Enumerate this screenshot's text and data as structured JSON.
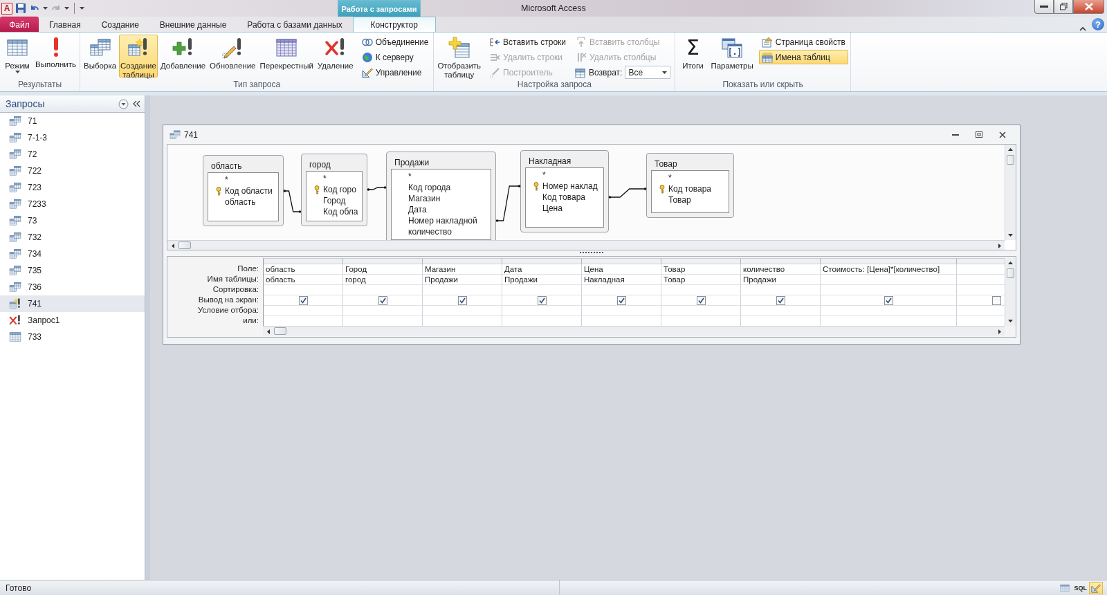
{
  "window": {
    "title": "Microsoft Access",
    "app_icon": "A",
    "help": "?"
  },
  "context_tab": {
    "label": "Работа с запросами"
  },
  "tabs": [
    {
      "label": "Файл",
      "kind": "file",
      "selected": false
    },
    {
      "label": "Главная",
      "kind": "tab",
      "selected": false
    },
    {
      "label": "Создание",
      "kind": "tab",
      "selected": false
    },
    {
      "label": "Внешние данные",
      "kind": "tab",
      "selected": false
    },
    {
      "label": "Работа с базами данных",
      "kind": "tab",
      "selected": false
    },
    {
      "label": "Конструктор",
      "kind": "tab",
      "selected": true
    }
  ],
  "ribbon": {
    "groups": [
      {
        "label": "Результаты",
        "items": [
          {
            "kind": "large",
            "label": "Режим",
            "dropdown": true,
            "selected": false
          },
          {
            "kind": "large",
            "label": "Выполнить",
            "selected": false
          }
        ]
      },
      {
        "label": "Тип запроса",
        "items": [
          {
            "kind": "large",
            "label": "Выборка",
            "selected": false
          },
          {
            "kind": "large",
            "label": "Создание таблицы",
            "selected": true
          },
          {
            "kind": "large",
            "label": "Добавление",
            "selected": false
          },
          {
            "kind": "large",
            "label": "Обновление",
            "selected": false
          },
          {
            "kind": "large",
            "label": "Перекрестный",
            "selected": false
          },
          {
            "kind": "large",
            "label": "Удаление",
            "selected": false
          },
          {
            "kind": "stack",
            "items": [
              {
                "kind": "small",
                "label": "Объединение",
                "disabled": false
              },
              {
                "kind": "small",
                "label": "К серверу",
                "disabled": false
              },
              {
                "kind": "small",
                "label": "Управление",
                "disabled": false
              }
            ]
          }
        ]
      },
      {
        "label": "Настройка запроса",
        "items": [
          {
            "kind": "large",
            "label": "Отобразить таблицу",
            "selected": false
          },
          {
            "kind": "stack",
            "items": [
              {
                "kind": "small",
                "label": "Вставить строки",
                "disabled": false
              },
              {
                "kind": "small",
                "label": "Удалить строки",
                "disabled": true
              },
              {
                "kind": "small",
                "label": "Построитель",
                "disabled": true
              }
            ]
          },
          {
            "kind": "stack",
            "items": [
              {
                "kind": "small",
                "label": "Вставить столбцы",
                "disabled": true
              },
              {
                "kind": "small",
                "label": "Удалить столбцы",
                "disabled": true
              },
              {
                "kind": "combo",
                "label": "Возврат:",
                "value": "Все"
              }
            ]
          }
        ]
      },
      {
        "label": "Показать или скрыть",
        "items": [
          {
            "kind": "large",
            "symbol": "Σ",
            "label": "Итоги",
            "selected": false
          },
          {
            "kind": "large",
            "label": "Параметры",
            "selected": false
          },
          {
            "kind": "stack",
            "items": [
              {
                "kind": "small",
                "label": "Страница свойств",
                "selected": false,
                "disabled": false
              },
              {
                "kind": "small",
                "label": "Имена таблиц",
                "selected": true,
                "disabled": false
              }
            ]
          }
        ]
      }
    ]
  },
  "nav": {
    "title": "Запросы",
    "items": [
      {
        "label": "71",
        "kind": "select",
        "selected": false
      },
      {
        "label": "7-1-3",
        "kind": "select",
        "selected": false
      },
      {
        "label": "72",
        "kind": "select",
        "selected": false
      },
      {
        "label": "722",
        "kind": "select",
        "selected": false
      },
      {
        "label": "723",
        "kind": "select",
        "selected": false
      },
      {
        "label": "7233",
        "kind": "select",
        "selected": false
      },
      {
        "label": "73",
        "kind": "select",
        "selected": false
      },
      {
        "label": "732",
        "kind": "select",
        "selected": false
      },
      {
        "label": "734",
        "kind": "select",
        "selected": false
      },
      {
        "label": "735",
        "kind": "select",
        "selected": false
      },
      {
        "label": "736",
        "kind": "select",
        "selected": false
      },
      {
        "label": "741",
        "kind": "maketable",
        "selected": true
      },
      {
        "label": "Запрос1",
        "kind": "delete",
        "selected": false
      },
      {
        "label": "733",
        "kind": "table",
        "selected": false
      }
    ]
  },
  "query": {
    "title": "741",
    "tables": [
      {
        "name": "область",
        "fields": [
          {
            "name": "*",
            "key": false
          },
          {
            "name": "Код области",
            "key": true
          },
          {
            "name": "область",
            "key": false
          }
        ]
      },
      {
        "name": "город",
        "fields": [
          {
            "name": "*",
            "key": false
          },
          {
            "name": "Код горо",
            "key": true
          },
          {
            "name": "Город",
            "key": false
          },
          {
            "name": "Код обла",
            "key": false
          }
        ]
      },
      {
        "name": "Продажи",
        "fields": [
          {
            "name": "*",
            "key": false
          },
          {
            "name": "Код города",
            "key": false
          },
          {
            "name": "Магазин",
            "key": false
          },
          {
            "name": "Дата",
            "key": false
          },
          {
            "name": "Номер накладной",
            "key": false
          },
          {
            "name": "количество",
            "key": false
          }
        ]
      },
      {
        "name": "Накладная",
        "fields": [
          {
            "name": "*",
            "key": false
          },
          {
            "name": "Номер наклад",
            "key": true
          },
          {
            "name": "Код товара",
            "key": false
          },
          {
            "name": "Цена",
            "key": false
          }
        ]
      },
      {
        "name": "Товар",
        "fields": [
          {
            "name": "*",
            "key": false
          },
          {
            "name": "Код товара",
            "key": true
          },
          {
            "name": "Товар",
            "key": false
          }
        ]
      }
    ],
    "grid": {
      "row_labels": [
        "Поле:",
        "Имя таблицы:",
        "Сортировка:",
        "Вывод на экран:",
        "Условие отбора:",
        "или:"
      ],
      "columns": [
        {
          "field": "область",
          "table": "область",
          "show": true
        },
        {
          "field": "Город",
          "table": "город",
          "show": true
        },
        {
          "field": "Магазин",
          "table": "Продажи",
          "show": true
        },
        {
          "field": "Дата",
          "table": "Продажи",
          "show": true
        },
        {
          "field": "Цена",
          "table": "Накладная",
          "show": true
        },
        {
          "field": "Товар",
          "table": "Товар",
          "show": true
        },
        {
          "field": "количество",
          "table": "Продажи",
          "show": true
        },
        {
          "field": "Стоимость: [Цена]*[количество]",
          "show": true
        },
        {
          "show": false
        }
      ]
    }
  },
  "status_bar": {
    "text": "Готово",
    "views": [
      {
        "kind": "datasheet",
        "selected": false
      },
      {
        "kind": "sql",
        "label": "SQL",
        "selected": false
      },
      {
        "kind": "design",
        "selected": true
      }
    ]
  }
}
